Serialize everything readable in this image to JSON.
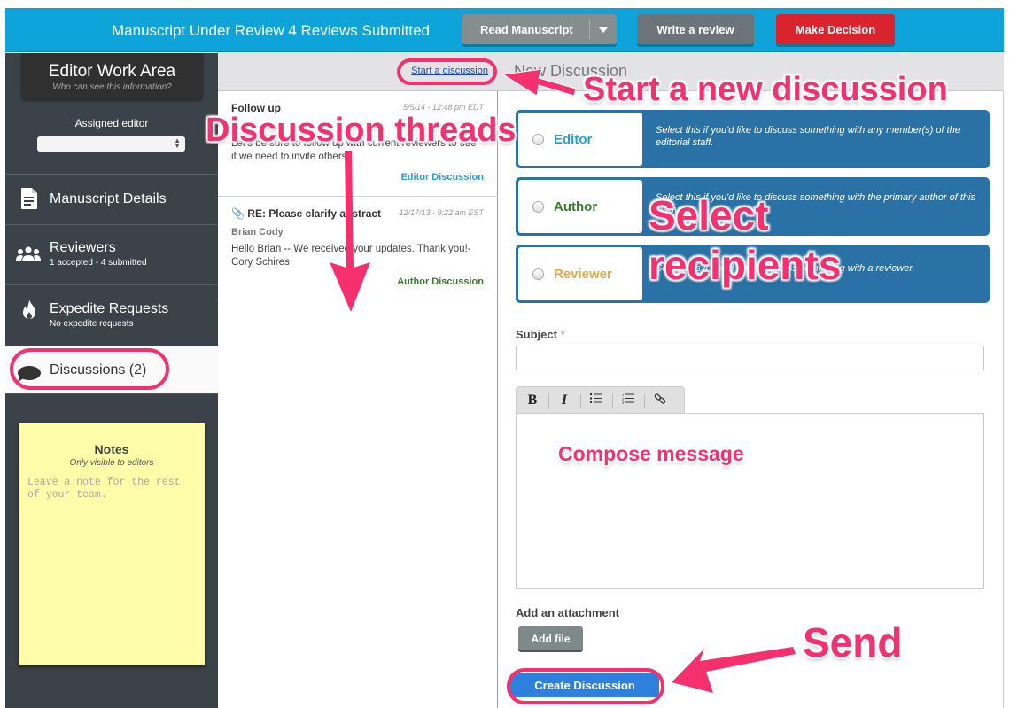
{
  "topbar": {
    "title": "Manuscript Under Review 4 Reviews Submitted",
    "read_manuscript": "Read Manuscript",
    "write_review": "Write a review",
    "make_decision": "Make Decision"
  },
  "sidebar": {
    "work_area_title": "Editor Work Area",
    "work_area_subtitle": "Who can see this information?",
    "assigned_editor_label": "Assigned editor",
    "assigned_editor_value": "",
    "items": [
      {
        "label": "Manuscript Details",
        "icon": "document-icon"
      },
      {
        "label": "Reviewers",
        "sub": "1 accepted - 4 submitted",
        "icon": "users-icon"
      },
      {
        "label": "Expedite Requests",
        "sub": "No expedite requests",
        "icon": "flame-icon"
      },
      {
        "label": "Discussions (2)",
        "icon": "speech-bubble-icon",
        "active": true
      }
    ],
    "notes": {
      "title": "Notes",
      "subtitle": "Only visible to editors",
      "placeholder": "Leave a note for the rest of your team."
    }
  },
  "threads_panel": {
    "start_link": "Start a discussion",
    "threads": [
      {
        "subject": "Follow up",
        "date": "5/5/14 - 12:48 pm EDT",
        "body": "Let's be sure to follow up with current reviewers to see if we need to invite others.",
        "type": "Editor Discussion",
        "type_color": "#2a9bd6"
      },
      {
        "subject": "RE: Please clarify abstract",
        "date": "12/17/13 - 9:22 am EST",
        "author": "Brian Cody",
        "body": "Hello Brian -- We received your updates. Thank you!- Cory Schires",
        "type": "Author Discussion",
        "type_color": "#3c7a2e",
        "has_attachment": true
      }
    ]
  },
  "new_discussion": {
    "title": "New Discussion",
    "recipients": [
      {
        "name": "Editor",
        "color": "#2a9bd6",
        "desc": "Select this if you'd like to discuss something with any member(s) of the editorial staff."
      },
      {
        "name": "Author",
        "color": "#3c7a2e",
        "desc": "Select this if you'd like to discuss something with the primary author of this study."
      },
      {
        "name": "Reviewer",
        "color": "#e0a94a",
        "desc": "Select this if you'd like to discuss something with a reviewer."
      }
    ],
    "subject_label": "Subject",
    "subject_required": "*",
    "subject_value": "",
    "toolbar": [
      "B",
      "I",
      "bullet-list",
      "numbered-list",
      "link"
    ],
    "attachment_label": "Add an attachment",
    "add_file": "Add file",
    "create": "Create Discussion"
  },
  "annotations": {
    "start_new": "Start a new discussion",
    "threads": "Discussion threads",
    "select_1": "Select",
    "select_2": "recipients",
    "compose": "Compose message",
    "send": "Send"
  },
  "colors": {
    "topbar": "#0ea3d9",
    "sidebar": "#3c4249",
    "recipient_bg": "#2a72a6",
    "decision": "#d9232d",
    "create": "#2f80dc",
    "annotation": "#f5306e",
    "notes": "#fdfca8"
  }
}
